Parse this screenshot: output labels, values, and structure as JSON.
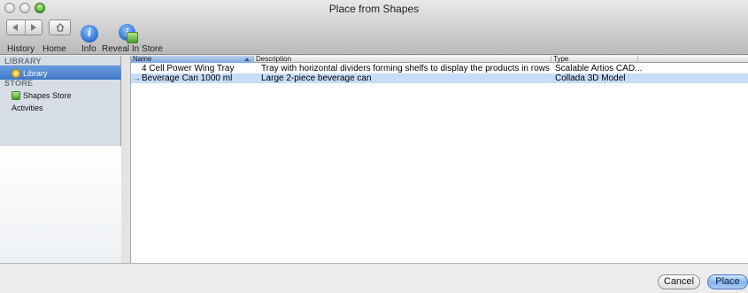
{
  "window": {
    "title": "Place from Shapes"
  },
  "toolbar": {
    "back_icon": "back-arrow-icon",
    "forward_icon": "forward-arrow-icon",
    "home_icon": "home-icon",
    "labels": {
      "history": "History",
      "home": "Home",
      "info": "Info",
      "reveal": "Reveal In Store"
    }
  },
  "sidebar": {
    "library_header": "LIBRARY",
    "store_header": "STORE",
    "items": [
      {
        "label": "Library",
        "icon": "library-icon",
        "selected": true
      },
      {
        "label": "Shapes Store",
        "icon": "shapes-store-icon",
        "selected": false
      },
      {
        "label": "Activities",
        "icon": "",
        "selected": false
      }
    ]
  },
  "table": {
    "columns": {
      "name": "Name",
      "description": "Description",
      "type": "Type"
    },
    "sort_column": "Name",
    "rows": [
      {
        "name": "4 Cell Power Wing Tray",
        "description": "Tray with horizontal dividers forming shelfs to display the products in rows",
        "type": "Scalable Artios CAD...",
        "selected": false
      },
      {
        "name": "Beverage Can 1000 ml",
        "description": "Large 2-piece beverage can",
        "type": "Collada 3D Model",
        "selected": true,
        "marker": "→"
      }
    ]
  },
  "buttons": {
    "cancel": "Cancel",
    "place": "Place"
  },
  "colors": {
    "selection_blue": "#3f78c8",
    "row_selection": "#c6dcf7",
    "sidebar_bg": "#d6dde5"
  }
}
